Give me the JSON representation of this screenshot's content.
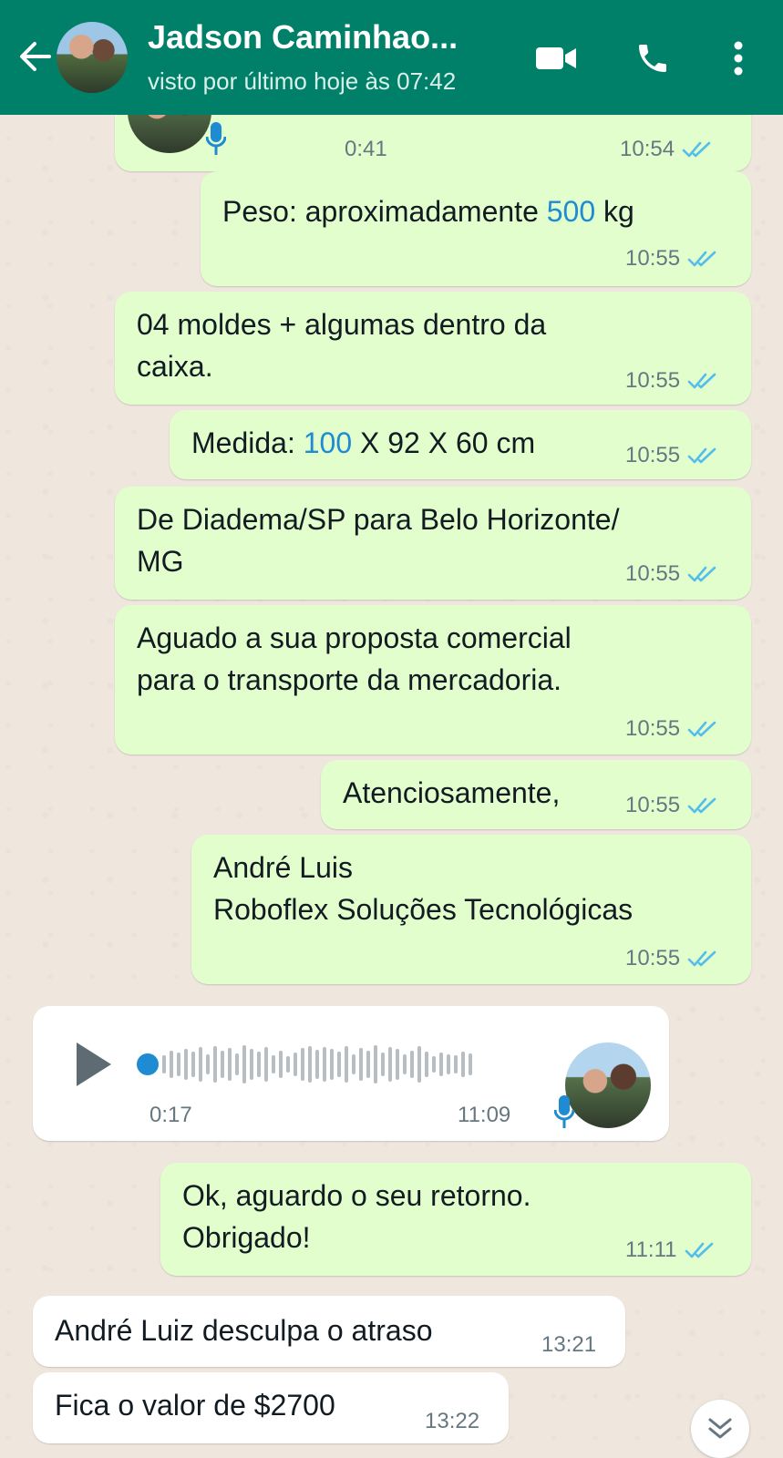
{
  "header": {
    "contact_name": "Jadson Caminhao...",
    "last_seen": "visto por último hoje às 07:42",
    "icons": [
      "back-arrow-icon",
      "video-call-icon",
      "phone-icon",
      "more-options-icon"
    ]
  },
  "messages": [
    {
      "type": "audio-out",
      "duration": "0:41",
      "time": "10:54"
    },
    {
      "type": "text-out",
      "line1_prefix": "Peso: aproximadamente ",
      "line1_number": "500",
      "line1_suffix": " kg",
      "time": "10:55"
    },
    {
      "type": "text-out",
      "line1": "04 moldes + algumas dentro da",
      "line2": "caixa.",
      "time": "10:55"
    },
    {
      "type": "text-out",
      "line1_prefix": "Medida: ",
      "line1_number": "100",
      "line1_suffix": " X 92 X 60 cm",
      "time": "10:55"
    },
    {
      "type": "text-out",
      "line1": "De Diadema/SP para Belo Horizonte/",
      "line2": "MG",
      "time": "10:55"
    },
    {
      "type": "text-out",
      "line1": "Aguado a sua proposta comercial",
      "line2": "para o transporte da mercadoria.",
      "time": "10:55"
    },
    {
      "type": "text-out",
      "line1": "Atenciosamente,",
      "time": "10:55"
    },
    {
      "type": "text-out",
      "line1": "André Luis",
      "line2": "Roboflex Soluções Tecnológicas",
      "time": "10:55"
    },
    {
      "type": "audio-in",
      "duration": "0:17",
      "time": "11:09",
      "progress": 0
    },
    {
      "type": "text-out",
      "line1": "Ok, aguardo o seu retorno.",
      "line2": "Obrigado!",
      "time": "11:11"
    },
    {
      "type": "text-in",
      "line1": "André Luiz desculpa o atraso",
      "time": "13:21"
    },
    {
      "type": "text-in",
      "line1": "Fica o valor de $2700",
      "time": "13:22"
    }
  ],
  "colors": {
    "header": "#008069",
    "outgoing_bubble": "#e3fecd",
    "incoming_bubble": "#ffffff",
    "read_ticks": "#53bdeb",
    "link_number": "#1e8bd2"
  }
}
